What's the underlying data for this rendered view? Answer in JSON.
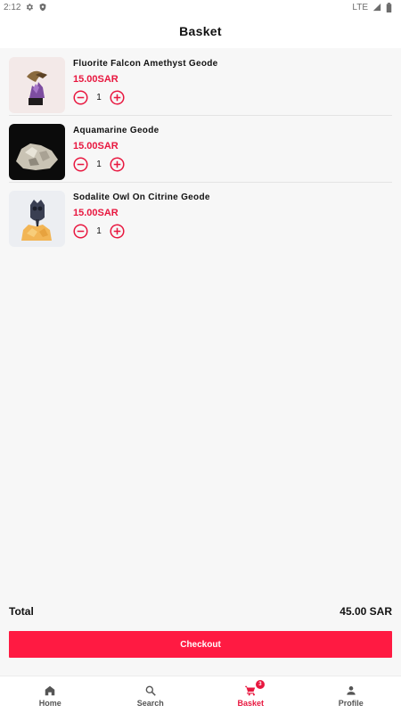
{
  "status_bar": {
    "time": "2:12",
    "network": "LTE"
  },
  "header": {
    "title": "Basket"
  },
  "items": [
    {
      "name": "Fluorite Falcon Amethyst Geode",
      "price": "15.00SAR",
      "quantity": "1"
    },
    {
      "name": "Aquamarine Geode",
      "price": "15.00SAR",
      "quantity": "1"
    },
    {
      "name": "Sodalite Owl On Citrine Geode",
      "price": "15.00SAR",
      "quantity": "1"
    }
  ],
  "summary": {
    "total_label": "Total",
    "total_value": "45.00 SAR"
  },
  "checkout": {
    "label": "Checkout"
  },
  "nav": {
    "items": [
      {
        "label": "Home",
        "icon": "home-icon"
      },
      {
        "label": "Search",
        "icon": "search-icon"
      },
      {
        "label": "Basket",
        "icon": "cart-icon",
        "badge": "3"
      },
      {
        "label": "Profile",
        "icon": "person-icon"
      }
    ]
  },
  "colors": {
    "accent": "#e8173f",
    "button": "#ff1a42",
    "background": "#f7f7f7"
  }
}
